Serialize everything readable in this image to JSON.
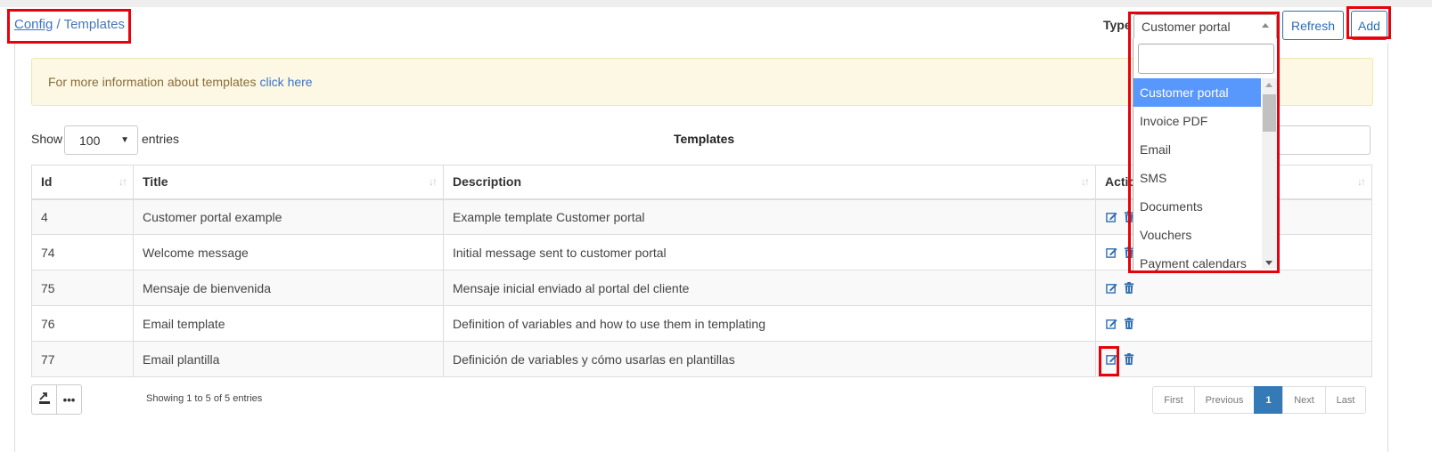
{
  "breadcrumb": {
    "parent": "Config",
    "separator": " / ",
    "current": "Templates"
  },
  "header": {
    "type_label": "Type",
    "type_selected": "Customer portal",
    "refresh_label": "Refresh",
    "add_label": "Add"
  },
  "info": {
    "text": "For more information about templates",
    "link": "click here"
  },
  "table_controls": {
    "show_label": "Show",
    "entries_value": "100",
    "entries_label": "entries",
    "title": "Templates"
  },
  "table": {
    "columns": [
      "Id",
      "Title",
      "Description",
      "Actions"
    ],
    "rows": [
      {
        "id": "4",
        "title": "Customer portal example",
        "description": "Example template Customer portal"
      },
      {
        "id": "74",
        "title": "Welcome message",
        "description": "Initial message sent to customer portal"
      },
      {
        "id": "75",
        "title": "Mensaje de bienvenida",
        "description": "Mensaje inicial enviado al portal del cliente"
      },
      {
        "id": "76",
        "title": "Email template",
        "description": "Definition of variables and how to use them in templating"
      },
      {
        "id": "77",
        "title": "Email plantilla",
        "description": "Definición de variables y cómo usarlas en plantillas"
      }
    ]
  },
  "footer": {
    "showing": "Showing 1 to 5 of 5 entries",
    "pagination": {
      "first": "First",
      "previous": "Previous",
      "current": "1",
      "next": "Next",
      "last": "Last"
    }
  },
  "dropdown": {
    "search_value": "",
    "options": [
      "Customer portal",
      "Invoice PDF",
      "Email",
      "SMS",
      "Documents",
      "Vouchers",
      "Payment calendars"
    ],
    "selected_option": "Customer portal"
  },
  "icons": {
    "edit": "edit-icon",
    "delete": "trash-icon",
    "export": "export-icon",
    "more": "more-icon"
  },
  "colors": {
    "accent": "#2d6db3",
    "highlight": "#e8000b",
    "selected_option": "#5897fb",
    "info_bg": "#fcf8e3",
    "pager_active": "#337ab7"
  }
}
